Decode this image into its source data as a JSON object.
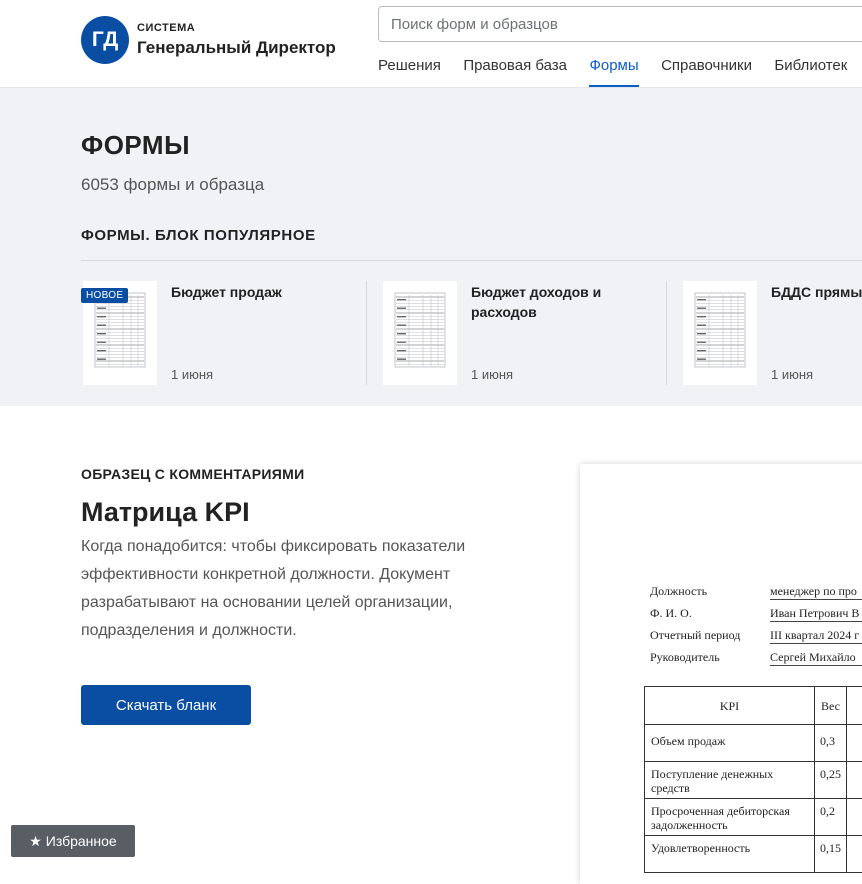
{
  "brand": {
    "logo_text": "ГД",
    "top_line": "СИСТЕМА",
    "name": "Генеральный Директор",
    "color": "#0a4ea3"
  },
  "search": {
    "placeholder": "Поиск форм и образцов"
  },
  "nav": {
    "items": [
      "Решения",
      "Правовая база",
      "Формы",
      "Справочники",
      "Библиотек"
    ],
    "active": "Формы"
  },
  "page": {
    "title": "ФОРМЫ",
    "count": "6053 формы и образца"
  },
  "popular": {
    "title": "ФОРМЫ. БЛОК ПОПУЛЯРНОЕ",
    "cards": [
      {
        "badge": "НОВОЕ",
        "title": "Бюджет продаж",
        "date": "1 июня"
      },
      {
        "title": "Бюджет доходов и расходов",
        "date": "1 июня"
      },
      {
        "title": "БДДС прямы",
        "date": "1 июня"
      }
    ]
  },
  "sample": {
    "kicker": "ОБРАЗЕЦ С КОММЕНТАРИЯМИ",
    "title": "Матрица KPI",
    "description": "Когда понадобится: чтобы фиксировать показатели эффективности конкретной должности. Документ разрабатывают на основании целей организации, подразделения и должности.",
    "button": "Скачать бланк"
  },
  "preview": {
    "fields": [
      {
        "label": "Должность",
        "value": "менеджер по про"
      },
      {
        "label": "Ф. И. О.",
        "value": "Иван Петрович В"
      },
      {
        "label": "Отчетный период",
        "value": "III квартал 2024 г"
      },
      {
        "label": "Руководитель",
        "value": "Сергей Михайло"
      }
    ],
    "table": {
      "headers": [
        "KPI",
        "Вес"
      ],
      "rows": [
        {
          "kpi": "Объем продаж",
          "weight": "0,3"
        },
        {
          "kpi": "Поступление денежных средств",
          "weight": "0,25"
        },
        {
          "kpi": "Просроченная дебиторская задолженность",
          "weight": "0,2"
        },
        {
          "kpi": "Удовлетворенность",
          "weight": "0,15"
        }
      ]
    }
  },
  "favorites": {
    "icon": "star-icon",
    "label": "Избранное"
  }
}
